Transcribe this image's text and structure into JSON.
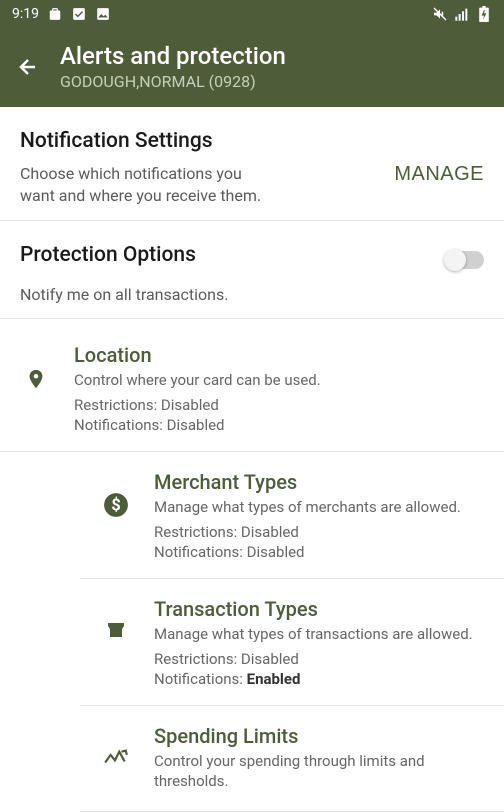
{
  "status": {
    "time": "9:19"
  },
  "header": {
    "title": "Alerts and protection",
    "subtitle": "GODOUGH,NORMAL (0928)"
  },
  "notification_section": {
    "title": "Notification Settings",
    "description": "Choose which notifications you want and where you receive them.",
    "manage_label": "MANAGE"
  },
  "protection_section": {
    "title": "Protection Options",
    "toggle_label": "Notify me on all transactions.",
    "toggle_on": false
  },
  "items": [
    {
      "title": "Location",
      "desc": "Control where your card can be used.",
      "restrictions_label": "Restrictions:",
      "restrictions": "Disabled",
      "notifications_label": "Notifications:",
      "notifications": "Disabled",
      "notif_enabled": false
    },
    {
      "title": "Merchant Types",
      "desc": "Manage what types of merchants are allowed.",
      "restrictions_label": "Restrictions:",
      "restrictions": "Disabled",
      "notifications_label": "Notifications:",
      "notifications": "Disabled",
      "notif_enabled": false
    },
    {
      "title": "Transaction Types",
      "desc": "Manage what types of transactions are allowed.",
      "restrictions_label": "Restrictions:",
      "restrictions": "Disabled",
      "notifications_label": "Notifications:",
      "notifications": "Enabled",
      "notif_enabled": true
    },
    {
      "title": "Spending Limits",
      "desc": "Control your spending through limits and thresholds.",
      "restrictions_label": "",
      "restrictions": "",
      "notifications_label": "",
      "notifications": "",
      "notif_enabled": false
    }
  ]
}
